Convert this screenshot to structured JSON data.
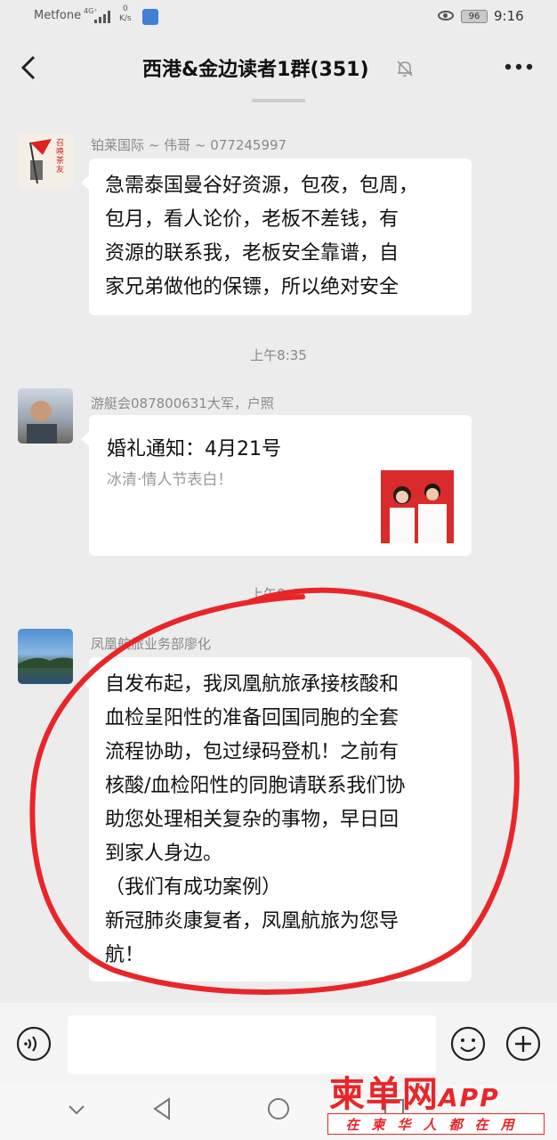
{
  "status_bar": {
    "carrier": "Metfone",
    "network": "4G⁺",
    "speed_value": "0",
    "speed_unit": "K/s",
    "battery": "96",
    "time": "9:16"
  },
  "header": {
    "title": "西港&金边读者1群(351)"
  },
  "timestamps": [
    "上午8:35",
    "上午8:42"
  ],
  "messages": [
    {
      "sender": "铂莱国际 ~ 伟哥 ~ 077245997",
      "avatar_text": "召唤茶友",
      "lines": [
        "急需泰国曼谷好资源，包夜，包周，",
        "包月，看人论价，老板不差钱，有",
        "资源的联系我，老板安全靠谱，自",
        "家兄弟做他的保镖，所以绝对安全"
      ]
    },
    {
      "sender": "游艇会087800631大军，户照",
      "link_title": "婚礼通知：4月21号",
      "link_desc": "冰清·情人节表白！"
    },
    {
      "sender": "凤凰航旅业务部廖化",
      "lines": [
        "自发布起，我凤凰航旅承接核酸和",
        "血检呈阳性的准备回国同胞的全套",
        "流程协助，包过绿码登机！之前有",
        "核酸/血检阳性的同胞请联系我们协",
        "助您处理相关复杂的事物，早日回",
        "到家人身边。",
        "（我们有成功案例）",
        "新冠肺炎康复者，凤凰航旅为您导",
        "航！"
      ]
    }
  ],
  "watermark": {
    "logo": "柬单网",
    "app": "APP",
    "tagline": "在柬华人都在用"
  },
  "colors": {
    "background": "#ececec",
    "bubble": "#ffffff",
    "annotation_red": "#e8262a"
  }
}
